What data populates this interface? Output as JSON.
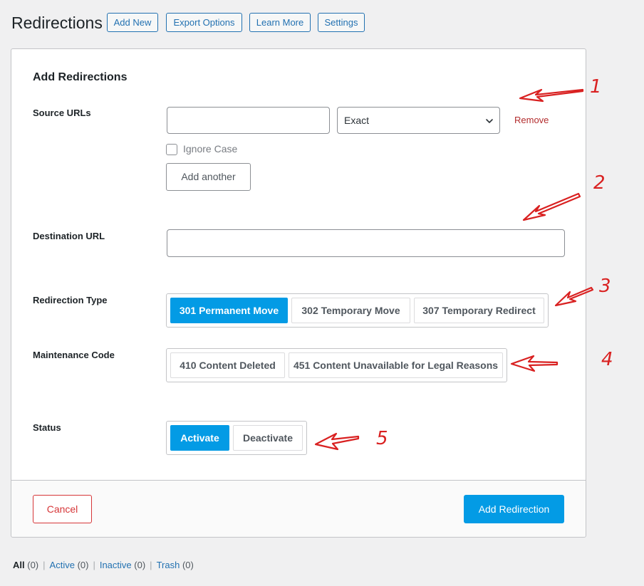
{
  "header": {
    "title": "Redirections",
    "buttons": [
      "Add New",
      "Export Options",
      "Learn More",
      "Settings"
    ]
  },
  "card": {
    "title": "Add Redirections",
    "source": {
      "label": "Source URLs",
      "url_value": "",
      "match_select": "Exact",
      "remove_label": "Remove",
      "ignore_case_label": "Ignore Case",
      "ignore_case_checked": false,
      "add_another_label": "Add another"
    },
    "destination": {
      "label": "Destination URL",
      "value": ""
    },
    "redirection_type": {
      "label": "Redirection Type",
      "options": [
        "301 Permanent Move",
        "302 Temporary Move",
        "307 Temporary Redirect"
      ],
      "selected": "301 Permanent Move"
    },
    "maintenance": {
      "label": "Maintenance Code",
      "options": [
        "410 Content Deleted",
        "451 Content Unavailable for Legal Reasons"
      ]
    },
    "status": {
      "label": "Status",
      "options": [
        "Activate",
        "Deactivate"
      ],
      "selected": "Activate"
    },
    "footer": {
      "cancel_label": "Cancel",
      "submit_label": "Add Redirection"
    }
  },
  "filters": [
    {
      "label": "All",
      "count": "(0)",
      "current": true
    },
    {
      "label": "Active",
      "count": "(0)",
      "current": false
    },
    {
      "label": "Inactive",
      "count": "(0)",
      "current": false
    },
    {
      "label": "Trash",
      "count": "(0)",
      "current": false
    }
  ],
  "annotations": {
    "numbers": [
      "1",
      "2",
      "3",
      "4",
      "5"
    ],
    "color": "#d92121"
  },
  "colors": {
    "accent": "#039be5",
    "link": "#2271b1",
    "danger": "#d63638",
    "remove": "#b32d2e"
  },
  "icons": {
    "select_arrow": "chevron-down-icon",
    "annotation": "red-arrow-icon"
  }
}
